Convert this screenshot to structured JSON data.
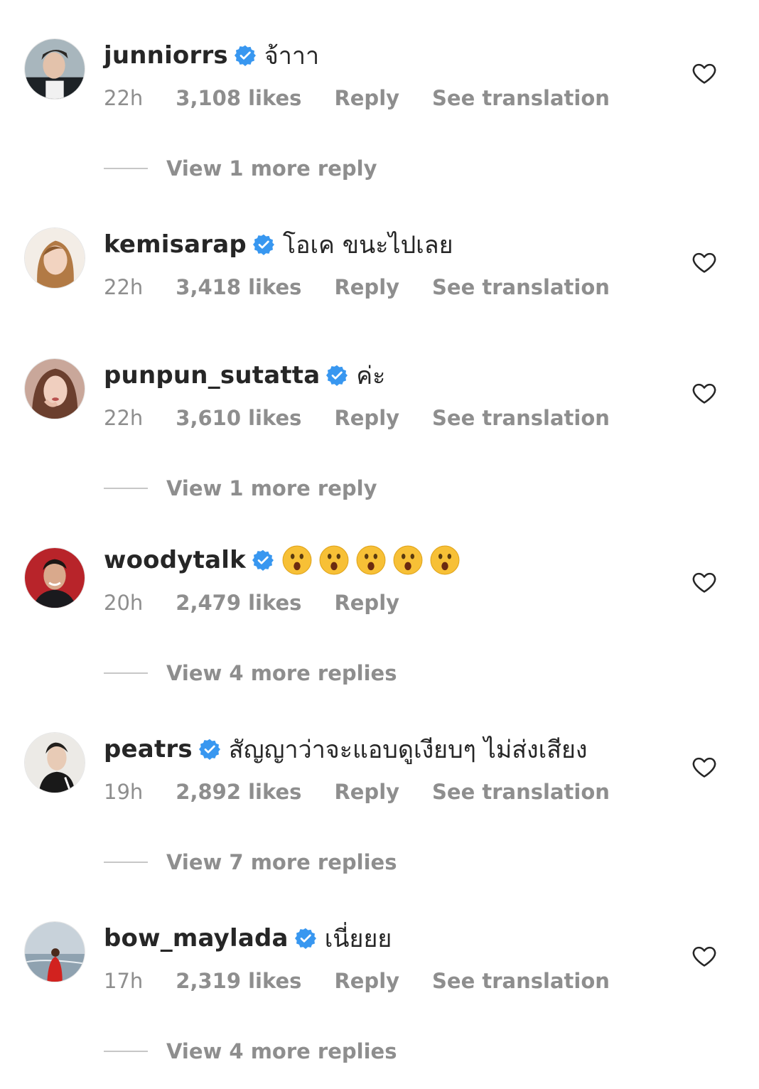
{
  "comments": [
    {
      "username": "junniorrs",
      "text": "จ้าาา",
      "time": "22h",
      "likes": "3,108 likes",
      "reply": "Reply",
      "translate": "See translation",
      "view_more": "View 1 more reply",
      "avatar": "avatar-junniorrs"
    },
    {
      "username": "kemisarap",
      "text": "โอเค ขนะไปเลย",
      "time": "22h",
      "likes": "3,418 likes",
      "reply": "Reply",
      "translate": "See translation",
      "avatar": "avatar-kemisarap"
    },
    {
      "username": "punpun_sutatta",
      "text": "ค่ะ",
      "time": "22h",
      "likes": "3,610 likes",
      "reply": "Reply",
      "translate": "See translation",
      "view_more": "View 1 more reply",
      "avatar": "avatar-punpun"
    },
    {
      "username": "woodytalk",
      "emojis": [
        "hushed-face-emoji",
        "hushed-face-emoji",
        "hushed-face-emoji",
        "hushed-face-emoji",
        "hushed-face-emoji"
      ],
      "time": "20h",
      "likes": "2,479 likes",
      "reply": "Reply",
      "view_more": "View 4 more replies",
      "avatar": "avatar-woodytalk"
    },
    {
      "username": "peatrs",
      "text": "สัญญาว่าจะแอบดูเงียบๆ ไม่ส่งเสียง",
      "time": "19h",
      "likes": "2,892 likes",
      "reply": "Reply",
      "translate": "See translation",
      "view_more": "View 7 more replies",
      "avatar": "avatar-peatrs"
    },
    {
      "username": "bow_maylada",
      "text": "เนี่ยยย",
      "time": "17h",
      "likes": "2,319 likes",
      "reply": "Reply",
      "translate": "See translation",
      "view_more": "View 4 more replies",
      "avatar": "avatar-bow"
    }
  ],
  "icons": {
    "verified": "verified-badge-icon",
    "like": "heart-icon"
  },
  "colors": {
    "verified": "#3897f0",
    "secondary_text": "#8e8e8e",
    "primary_text": "#262626"
  }
}
